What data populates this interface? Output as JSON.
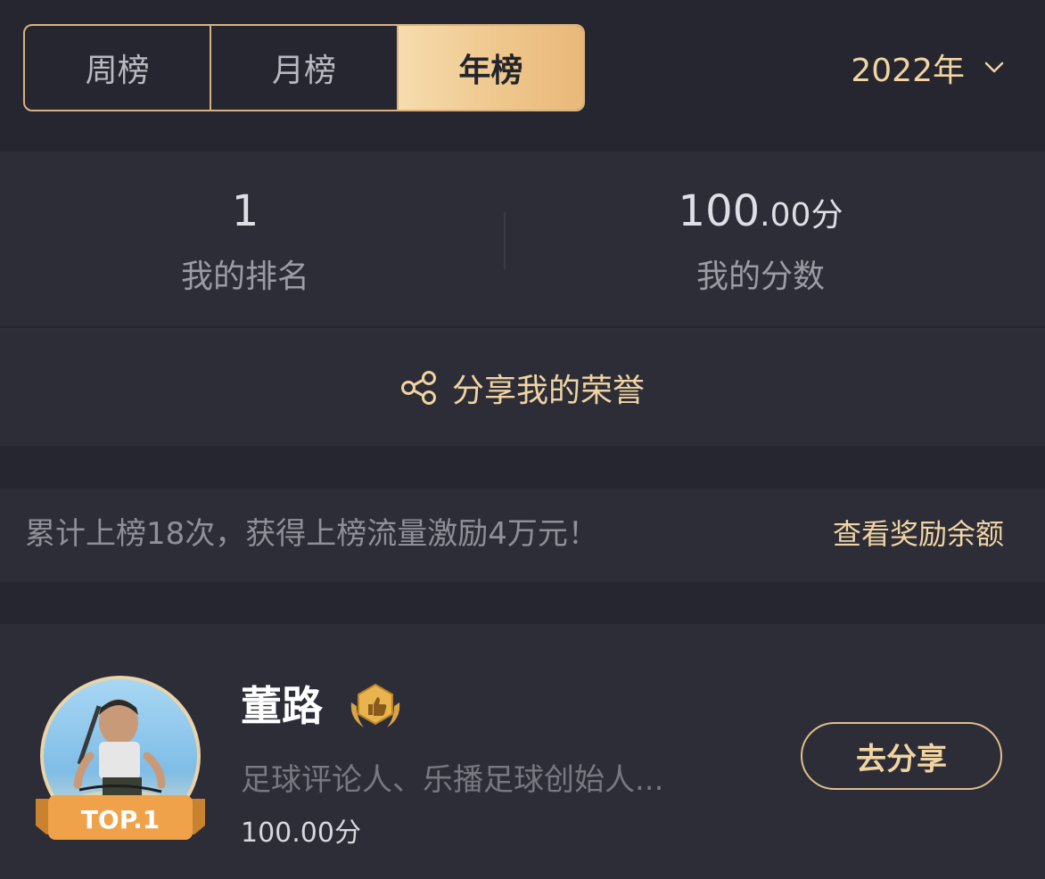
{
  "tabs": [
    {
      "label": "周榜"
    },
    {
      "label": "月榜"
    },
    {
      "label": "年榜"
    }
  ],
  "active_tab": "年榜",
  "year_select": {
    "label": "2022年"
  },
  "stats": {
    "rank": {
      "value": "1",
      "label": "我的排名"
    },
    "score": {
      "int": "100",
      "dec": ".00",
      "unit": "分",
      "label": "我的分数"
    }
  },
  "share": {
    "label": "分享我的荣誉"
  },
  "reward": {
    "text": "累计上榜18次，获得上榜流量激励4万元！",
    "link": "查看奖励余额"
  },
  "entry": {
    "rank_label": "TOP.1",
    "name": "董路",
    "description": "足球评论人、乐播足球创始人...",
    "score": "100.00分",
    "button": "去分享"
  },
  "colors": {
    "accent": "#f1d4a2",
    "background": "#25262f",
    "panel": "#2c2d37",
    "ribbon": "#f0a24a"
  }
}
